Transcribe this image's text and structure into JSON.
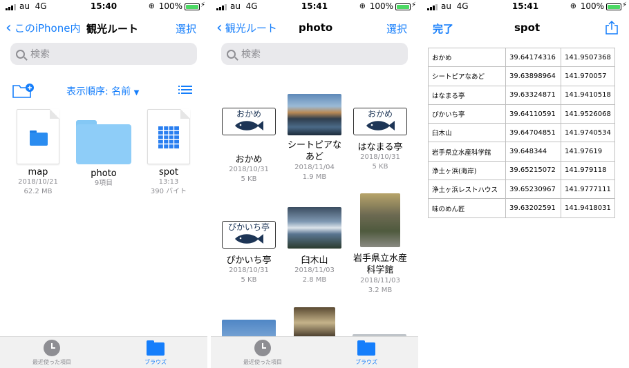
{
  "status": {
    "carrier": "au",
    "network": "4G",
    "battery": "100%",
    "time_1": "15:40",
    "time_2": "15:41",
    "time_3": "15:41"
  },
  "panel1": {
    "back_label": "このiPhone内",
    "title": "観光ルート",
    "select_label": "選択",
    "search_placeholder": "検索",
    "sort_label": "表示順序: 名前",
    "files": [
      {
        "name": "map",
        "meta1": "2018/10/21",
        "meta2": "62.2 MB"
      },
      {
        "name": "photo",
        "meta1": "9項目",
        "meta2": ""
      },
      {
        "name": "spot",
        "meta1": "13:13",
        "meta2": "390 バイト"
      }
    ]
  },
  "panel2": {
    "back_label": "観光ルート",
    "title": "photo",
    "select_label": "選択",
    "search_placeholder": "検索",
    "files": [
      {
        "name": "おかめ",
        "thumb": "fish",
        "card_label": "おかめ",
        "meta1": "2018/10/31",
        "meta2": "5 KB"
      },
      {
        "name": "シートピアなあど",
        "thumb": "photo",
        "meta1": "2018/11/04",
        "meta2": "1.9 MB"
      },
      {
        "name": "はなまる亭",
        "thumb": "fish",
        "card_label": "おかめ",
        "meta1": "2018/10/31",
        "meta2": "5 KB"
      },
      {
        "name": "ぴかいち亭",
        "thumb": "fish",
        "card_label": "ぴかいち亭",
        "meta1": "2018/10/31",
        "meta2": "5 KB"
      },
      {
        "name": "臼木山",
        "thumb": "photo",
        "meta1": "2018/11/03",
        "meta2": "2.8 MB"
      },
      {
        "name": "岩手県立水産科学館",
        "thumb": "photo",
        "meta1": "2018/11/03",
        "meta2": "3.2 MB"
      }
    ]
  },
  "panel3": {
    "done_label": "完了",
    "title": "spot",
    "rows": [
      [
        "おかめ",
        "39.64174316",
        "141.9507368"
      ],
      [
        "シートピアなあど",
        "39.63898964",
        "141.970057"
      ],
      [
        "はなまる亭",
        "39.63324871",
        "141.9410518"
      ],
      [
        "ぴかいち亭",
        "39.64110591",
        "141.9526068"
      ],
      [
        "臼木山",
        "39.64704851",
        "141.9740534"
      ],
      [
        "岩手県立水産科学館",
        "39.648344",
        "141.97619"
      ],
      [
        "浄土ヶ浜(海岸)",
        "39.65215072",
        "141.979118"
      ],
      [
        "浄土ヶ浜レストハウス",
        "39.65230967",
        "141.9777111"
      ],
      [
        "味のめん匠",
        "39.63202591",
        "141.9418031"
      ]
    ]
  },
  "tabbar": {
    "recents_label": "最近使った項目",
    "browse_label": "ブラウズ"
  },
  "colors": {
    "accent": "#157efb",
    "folder": "#8ecdf8",
    "battery": "#4cd964"
  }
}
